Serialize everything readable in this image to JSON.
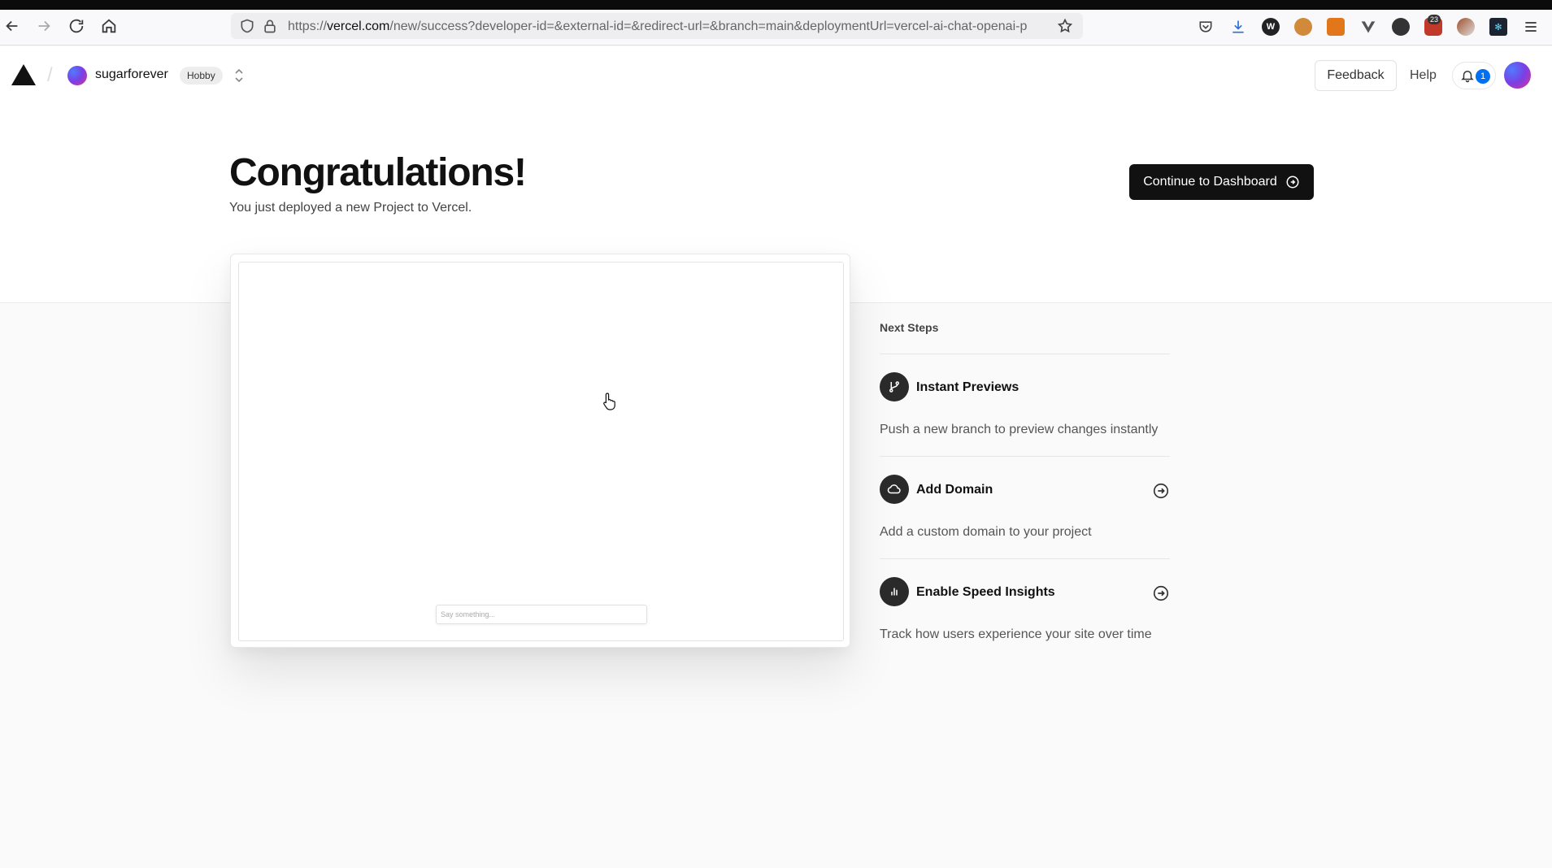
{
  "browser": {
    "url_prefix": "https://",
    "url_host": "vercel.com",
    "url_path": "/new/success?developer-id=&external-id=&redirect-url=&branch=main&deploymentUrl=vercel-ai-chat-openai-p",
    "extensions": [
      "pocket-icon",
      "download-icon",
      "wikipedia-icon",
      "cookie-icon",
      "metamask-icon",
      "vue-devtools-icon",
      "dark-mode-icon",
      "ublock-icon",
      "tampermonkey-icon",
      "react-devtools-icon",
      "menu-icon"
    ],
    "ublock_badge": "23"
  },
  "header": {
    "team_name": "sugarforever",
    "plan_badge": "Hobby",
    "feedback": "Feedback",
    "help": "Help",
    "notification_count": "1"
  },
  "hero": {
    "title": "Congratulations!",
    "subtitle": "You just deployed a new Project to Vercel.",
    "cta_label": "Continue to Dashboard"
  },
  "preview": {
    "input_placeholder": "Say something..."
  },
  "next_steps": {
    "title": "Next Steps",
    "items": [
      {
        "name": "Instant Previews",
        "desc": "Push a new branch to preview changes instantly",
        "icon": "git-branch-icon"
      },
      {
        "name": "Add Domain",
        "desc": "Add a custom domain to your project",
        "icon": "cloud-icon"
      },
      {
        "name": "Enable Speed Insights",
        "desc": "Track how users experience your site over time",
        "icon": "bar-chart-icon"
      }
    ]
  },
  "colors": {
    "accent": "#0070f3",
    "primary_button": "#111111",
    "page_bg": "#fafafa"
  }
}
